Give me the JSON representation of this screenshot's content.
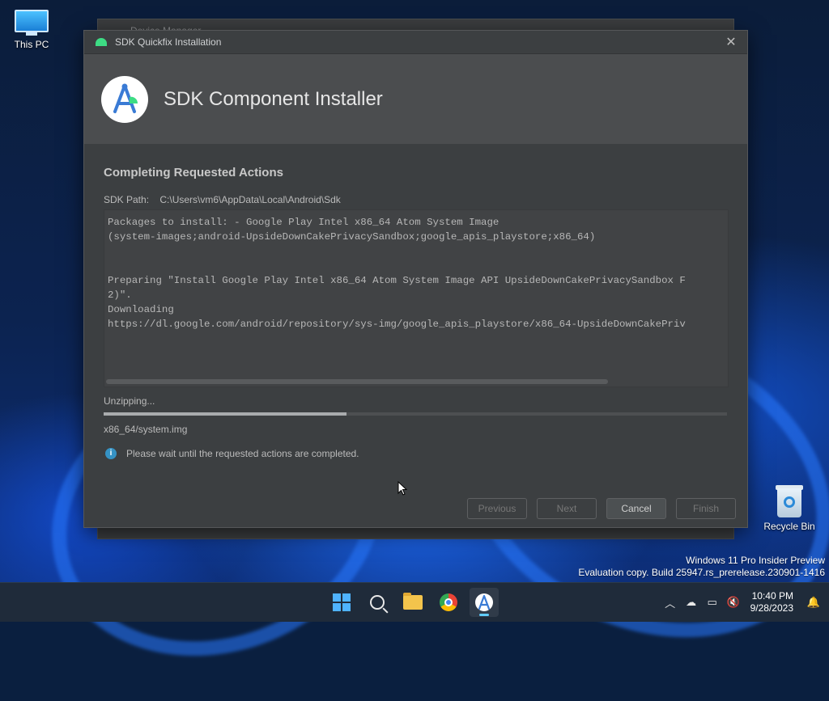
{
  "desktop": {
    "icons": [
      {
        "label": "This PC"
      },
      {
        "label": "Recycle Bin"
      }
    ],
    "watermark": {
      "line1": "Windows 11 Pro Insider Preview",
      "line2": "Evaluation copy. Build 25947.rs_prerelease.230901-1416"
    }
  },
  "background_window": {
    "title": "Device Manager"
  },
  "dialog": {
    "title": "SDK Quickfix Installation",
    "header_title": "SDK Component Installer",
    "section_title": "Completing Requested Actions",
    "sdk_path_label": "SDK Path:",
    "sdk_path_value": "C:\\Users\\vm6\\AppData\\Local\\Android\\Sdk",
    "console_text": "Packages to install: - Google Play Intel x86_64 Atom System Image\n(system-images;android-UpsideDownCakePrivacySandbox;google_apis_playstore;x86_64)\n\n\nPreparing \"Install Google Play Intel x86_64 Atom System Image API UpsideDownCakePrivacySandbox F\n2)\".\nDownloading\nhttps://dl.google.com/android/repository/sys-img/google_apis_playstore/x86_64-UpsideDownCakePriv",
    "status_text": "Unzipping...",
    "progress_fraction": 0.39,
    "current_file": "x86_64/system.img",
    "info_text": "Please wait until the requested actions are completed.",
    "buttons": {
      "previous": "Previous",
      "next": "Next",
      "cancel": "Cancel",
      "finish": "Finish"
    },
    "accent_color": "#3ddc84"
  },
  "taskbar": {
    "apps": [
      "start-icon",
      "search-icon",
      "file-explorer-icon",
      "chrome-icon",
      "android-studio-icon"
    ],
    "clock": {
      "time": "10:40 PM",
      "date": "9/28/2023"
    }
  }
}
